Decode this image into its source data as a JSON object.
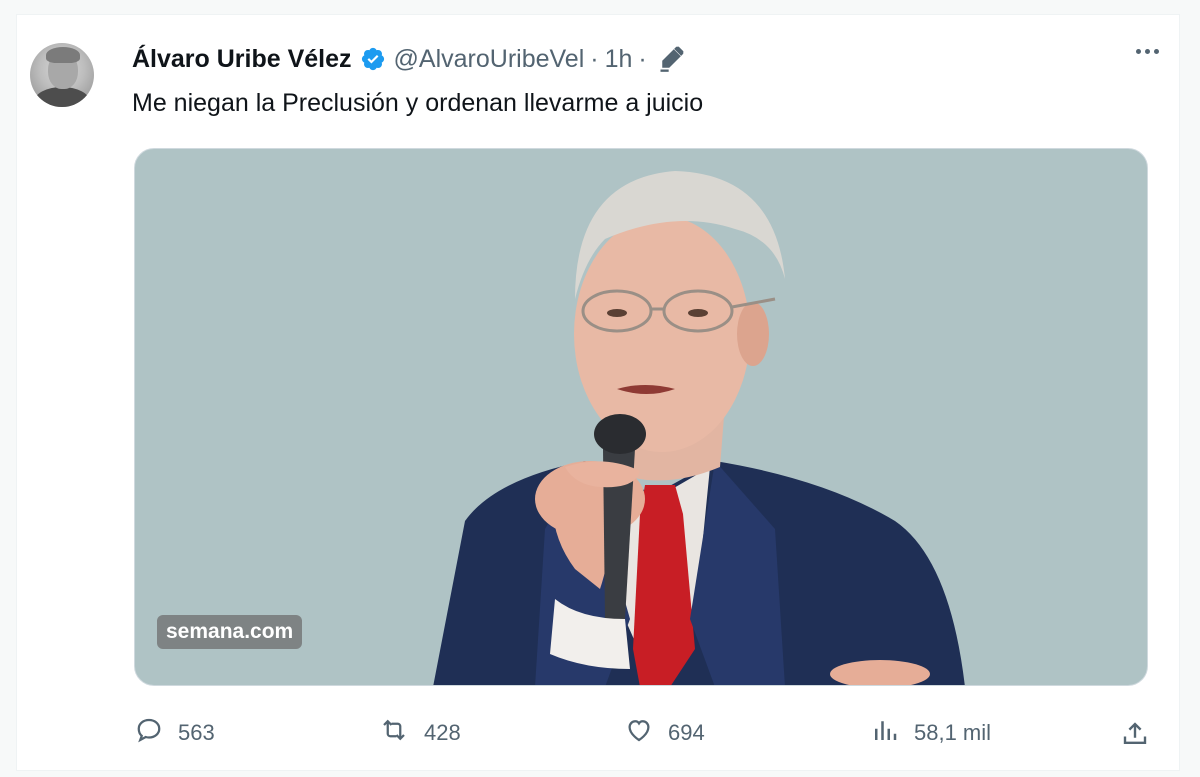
{
  "tweet": {
    "author_name": "Álvaro Uribe Vélez",
    "handle": "@AlvaroUribeVel",
    "separator": "·",
    "time": "1h",
    "text": "Me niegan la Preclusión y ordenan llevarme a juicio",
    "verified_icon": "verified-badge-icon",
    "edited_icon": "edit-pencil-icon",
    "more_icon": "more-options-icon"
  },
  "media": {
    "watermark": "semana.com",
    "background_color": "#afc3c5"
  },
  "actions": {
    "replies": "563",
    "reposts": "428",
    "likes": "694",
    "views": "58,1 mil"
  },
  "colors": {
    "verified": "#1d9bf0",
    "muted": "#536471",
    "text": "#0f1419"
  }
}
